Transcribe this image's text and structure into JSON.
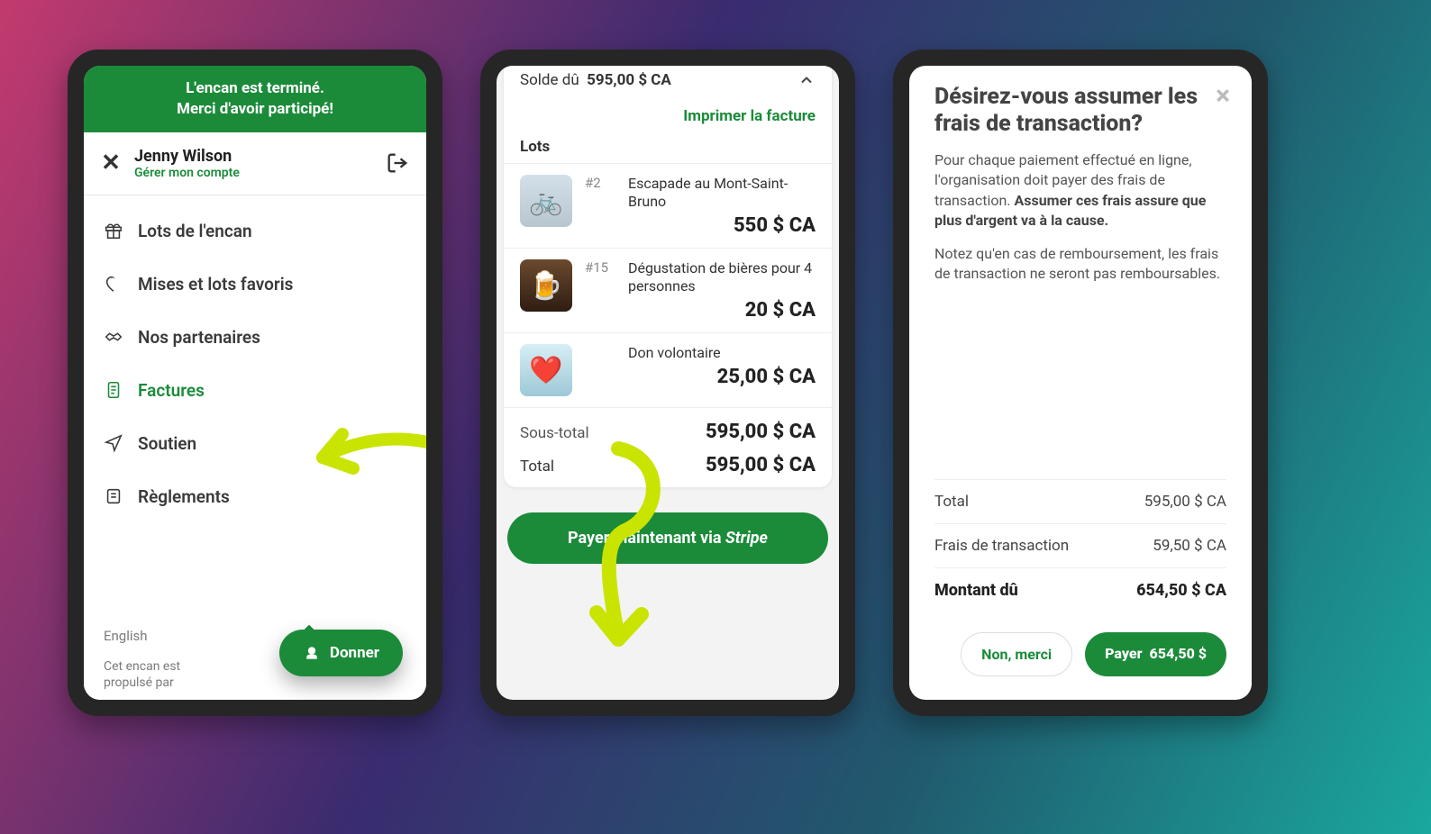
{
  "panel1": {
    "banner_line1": "L'encan est terminé.",
    "banner_line2": "Merci d'avoir participé!",
    "user_name": "Jenny Wilson",
    "manage_label": "Gérer mon compte",
    "menu": {
      "lots": "Lots de l'encan",
      "favorites": "Mises et lots favoris",
      "partners": "Nos partenaires",
      "invoices": "Factures",
      "support": "Soutien",
      "rules": "Règlements"
    },
    "language": "English",
    "powered_by": "Cet encan est propulsé par",
    "donate_label": "Donner"
  },
  "panel2": {
    "balance_label": "Solde dû",
    "balance_value": "595,00 $ CA",
    "print_label": "Imprimer la facture",
    "lots_heading": "Lots",
    "items": [
      {
        "num": "#2",
        "title": "Escapade au Mont-Saint-Bruno",
        "price": "550 $ CA",
        "thumb": "bike"
      },
      {
        "num": "#15",
        "title": "Dégustation de bières pour 4 personnes",
        "price": "20 $ CA",
        "thumb": "beer"
      },
      {
        "num": "",
        "title": "Don volontaire",
        "price": "25,00 $ CA",
        "thumb": "heart"
      }
    ],
    "subtotal_label": "Sous-total",
    "subtotal_value": "595,00 $ CA",
    "total_label": "Total",
    "total_value": "595,00 $ CA",
    "pay_label_pre": "Payer maintenant via ",
    "pay_label_brand": "Stripe"
  },
  "panel3": {
    "heading": "Désirez-vous assumer les frais de transaction?",
    "para1_pre": "Pour chaque paiement effectué en ligne, l'organisation doit payer des frais de transaction. ",
    "para1_bold": "Assumer ces frais assure que plus d'argent va à la cause.",
    "para2": "Notez qu'en cas de remboursement, les frais de transaction ne seront pas remboursables.",
    "rows": {
      "total_label": "Total",
      "total_value": "595,00 $ CA",
      "fees_label": "Frais de transaction",
      "fees_value": "59,50 $ CA",
      "due_label": "Montant dû",
      "due_value": "654,50 $ CA"
    },
    "decline_label": "Non, merci",
    "pay_label": "Payer",
    "pay_amount": "654,50 $"
  }
}
